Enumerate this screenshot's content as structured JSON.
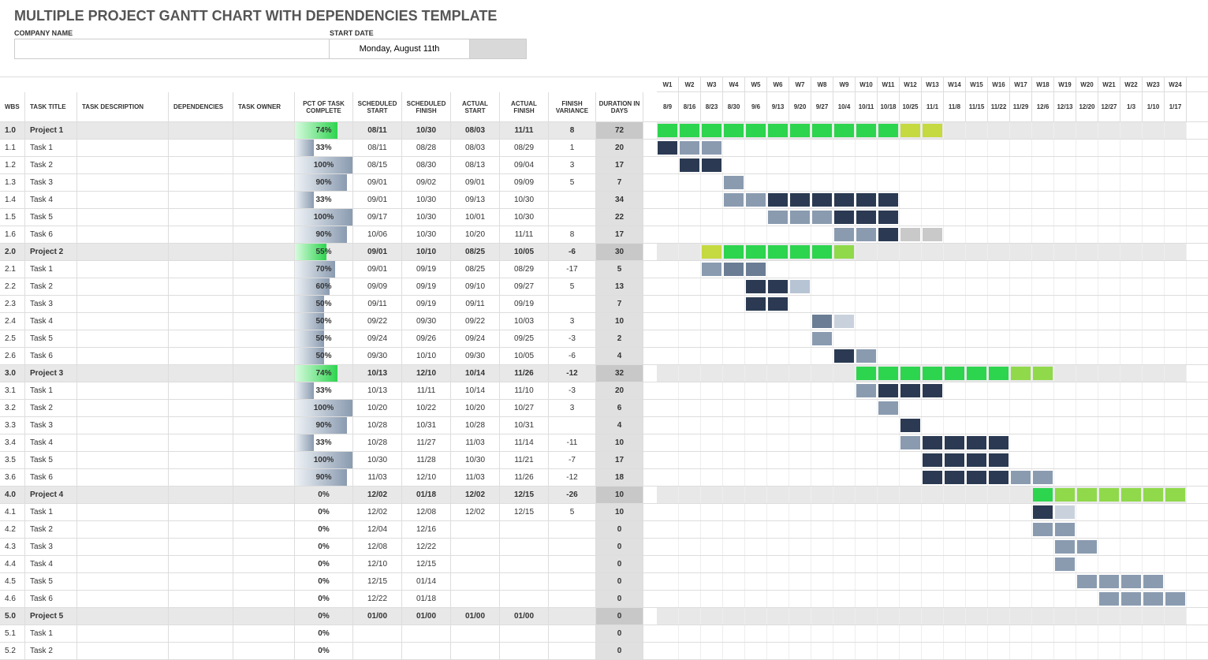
{
  "page_title": "MULTIPLE PROJECT GANTT CHART WITH DEPENDENCIES TEMPLATE",
  "labels": {
    "company": "COMPANY NAME",
    "start_date": "START DATE"
  },
  "start_date": "Monday, August 11th",
  "columns": {
    "wbs": "WBS",
    "title": "TASK TITLE",
    "desc": "TASK DESCRIPTION",
    "dep": "DEPENDENCIES",
    "own": "TASK OWNER",
    "pct": "PCT OF TASK COMPLETE",
    "ss": "SCHEDULED START",
    "sf": "SCHEDULED FINISH",
    "as": "ACTUAL START",
    "af": "ACTUAL FINISH",
    "var": "FINISH VARIANCE",
    "dur": "DURATION IN DAYS"
  },
  "weeks": [
    {
      "w": "W1",
      "d": "8/9"
    },
    {
      "w": "W2",
      "d": "8/16"
    },
    {
      "w": "W3",
      "d": "8/23"
    },
    {
      "w": "W4",
      "d": "8/30"
    },
    {
      "w": "W5",
      "d": "9/6"
    },
    {
      "w": "W6",
      "d": "9/13"
    },
    {
      "w": "W7",
      "d": "9/20"
    },
    {
      "w": "W8",
      "d": "9/27"
    },
    {
      "w": "W9",
      "d": "10/4"
    },
    {
      "w": "W10",
      "d": "10/11"
    },
    {
      "w": "W11",
      "d": "10/18"
    },
    {
      "w": "W12",
      "d": "10/25"
    },
    {
      "w": "W13",
      "d": "11/1"
    },
    {
      "w": "W14",
      "d": "11/8"
    },
    {
      "w": "W15",
      "d": "11/15"
    },
    {
      "w": "W16",
      "d": "11/22"
    },
    {
      "w": "W17",
      "d": "11/29"
    },
    {
      "w": "W18",
      "d": "12/6"
    },
    {
      "w": "W19",
      "d": "12/13"
    },
    {
      "w": "W20",
      "d": "12/20"
    },
    {
      "w": "W21",
      "d": "12/27"
    },
    {
      "w": "W22",
      "d": "1/3"
    },
    {
      "w": "W23",
      "d": "1/10"
    },
    {
      "w": "W24",
      "d": "1/17"
    }
  ],
  "rows": [
    {
      "proj": true,
      "wbs": "1.0",
      "title": "Project 1",
      "pct": "74%",
      "pctv": 74,
      "ss": "08/11",
      "sf": "10/30",
      "as": "08/03",
      "af": "11/11",
      "var": "8",
      "dur": "72",
      "bars": [
        {
          "s": 0,
          "e": 11,
          "c": "#2dd44e"
        },
        {
          "s": 11,
          "e": 13,
          "c": "#c5d941"
        }
      ]
    },
    {
      "wbs": "1.1",
      "title": "Task 1",
      "pct": "33%",
      "pctv": 33,
      "ss": "08/11",
      "sf": "08/28",
      "as": "08/03",
      "af": "08/29",
      "var": "1",
      "dur": "20",
      "bars": [
        {
          "s": 0,
          "e": 1,
          "c": "#2b3a52"
        },
        {
          "s": 1,
          "e": 3,
          "c": "#8a9bb0"
        }
      ]
    },
    {
      "wbs": "1.2",
      "title": "Task 2",
      "pct": "100%",
      "pctv": 100,
      "ss": "08/15",
      "sf": "08/30",
      "as": "08/13",
      "af": "09/04",
      "var": "3",
      "dur": "17",
      "bars": [
        {
          "s": 1,
          "e": 3,
          "c": "#2b3a52"
        }
      ]
    },
    {
      "wbs": "1.3",
      "title": "Task 3",
      "pct": "90%",
      "pctv": 90,
      "ss": "09/01",
      "sf": "09/02",
      "as": "09/01",
      "af": "09/09",
      "var": "5",
      "dur": "7",
      "bars": [
        {
          "s": 3,
          "e": 4,
          "c": "#8a9bb0"
        }
      ]
    },
    {
      "wbs": "1.4",
      "title": "Task 4",
      "pct": "33%",
      "pctv": 33,
      "ss": "09/01",
      "sf": "10/30",
      "as": "09/13",
      "af": "10/30",
      "var": "",
      "dur": "34",
      "bars": [
        {
          "s": 3,
          "e": 5,
          "c": "#8a9bb0"
        },
        {
          "s": 5,
          "e": 11,
          "c": "#2b3a52"
        }
      ]
    },
    {
      "wbs": "1.5",
      "title": "Task 5",
      "pct": "100%",
      "pctv": 100,
      "ss": "09/17",
      "sf": "10/30",
      "as": "10/01",
      "af": "10/30",
      "var": "",
      "dur": "22",
      "bars": [
        {
          "s": 5,
          "e": 8,
          "c": "#8a9bb0"
        },
        {
          "s": 8,
          "e": 11,
          "c": "#2b3a52"
        }
      ]
    },
    {
      "wbs": "1.6",
      "title": "Task 6",
      "pct": "90%",
      "pctv": 90,
      "ss": "10/06",
      "sf": "10/30",
      "as": "10/20",
      "af": "11/11",
      "var": "8",
      "dur": "17",
      "bars": [
        {
          "s": 8,
          "e": 10,
          "c": "#8a9bb0"
        },
        {
          "s": 10,
          "e": 11,
          "c": "#2b3a52"
        },
        {
          "s": 11,
          "e": 13,
          "c": "#c9c9c9"
        }
      ]
    },
    {
      "proj": true,
      "wbs": "2.0",
      "title": "Project 2",
      "pct": "55%",
      "pctv": 55,
      "ss": "09/01",
      "sf": "10/10",
      "as": "08/25",
      "af": "10/05",
      "var": "-6",
      "dur": "30",
      "bars": [
        {
          "s": 2,
          "e": 3,
          "c": "#c5d941"
        },
        {
          "s": 3,
          "e": 8,
          "c": "#2dd44e"
        },
        {
          "s": 8,
          "e": 9,
          "c": "#8fd94a"
        }
      ]
    },
    {
      "wbs": "2.1",
      "title": "Task 1",
      "pct": "70%",
      "pctv": 70,
      "ss": "09/01",
      "sf": "09/19",
      "as": "08/25",
      "af": "08/29",
      "var": "-17",
      "dur": "5",
      "bars": [
        {
          "s": 2,
          "e": 3,
          "c": "#8a9bb0"
        },
        {
          "s": 3,
          "e": 5,
          "c": "#6a7d94"
        }
      ]
    },
    {
      "wbs": "2.2",
      "title": "Task 2",
      "pct": "60%",
      "pctv": 60,
      "ss": "09/09",
      "sf": "09/19",
      "as": "09/10",
      "af": "09/27",
      "var": "5",
      "dur": "13",
      "bars": [
        {
          "s": 4,
          "e": 6,
          "c": "#2b3a52"
        },
        {
          "s": 6,
          "e": 7,
          "c": "#b7c4d4"
        }
      ]
    },
    {
      "wbs": "2.3",
      "title": "Task 3",
      "pct": "50%",
      "pctv": 50,
      "ss": "09/11",
      "sf": "09/19",
      "as": "09/11",
      "af": "09/19",
      "var": "",
      "dur": "7",
      "bars": [
        {
          "s": 4,
          "e": 6,
          "c": "#2b3a52"
        }
      ]
    },
    {
      "wbs": "2.4",
      "title": "Task 4",
      "pct": "50%",
      "pctv": 50,
      "ss": "09/22",
      "sf": "09/30",
      "as": "09/22",
      "af": "10/03",
      "var": "3",
      "dur": "10",
      "bars": [
        {
          "s": 7,
          "e": 8,
          "c": "#6a7d94"
        },
        {
          "s": 8,
          "e": 9,
          "c": "#c9d2dc"
        }
      ]
    },
    {
      "wbs": "2.5",
      "title": "Task 5",
      "pct": "50%",
      "pctv": 50,
      "ss": "09/24",
      "sf": "09/26",
      "as": "09/24",
      "af": "09/25",
      "var": "-3",
      "dur": "2",
      "bars": [
        {
          "s": 7,
          "e": 8,
          "c": "#8a9bb0"
        }
      ]
    },
    {
      "wbs": "2.6",
      "title": "Task 6",
      "pct": "50%",
      "pctv": 50,
      "ss": "09/30",
      "sf": "10/10",
      "as": "09/30",
      "af": "10/05",
      "var": "-6",
      "dur": "4",
      "bars": [
        {
          "s": 8,
          "e": 9,
          "c": "#2b3a52"
        },
        {
          "s": 9,
          "e": 10,
          "c": "#8a9bb0"
        }
      ]
    },
    {
      "proj": true,
      "wbs": "3.0",
      "title": "Project 3",
      "pct": "74%",
      "pctv": 74,
      "ss": "10/13",
      "sf": "12/10",
      "as": "10/14",
      "af": "11/26",
      "var": "-12",
      "dur": "32",
      "bars": [
        {
          "s": 9,
          "e": 16,
          "c": "#2dd44e"
        },
        {
          "s": 16,
          "e": 18,
          "c": "#8fd94a"
        }
      ]
    },
    {
      "wbs": "3.1",
      "title": "Task 1",
      "pct": "33%",
      "pctv": 33,
      "ss": "10/13",
      "sf": "11/11",
      "as": "10/14",
      "af": "11/10",
      "var": "-3",
      "dur": "20",
      "bars": [
        {
          "s": 9,
          "e": 10,
          "c": "#8a9bb0"
        },
        {
          "s": 10,
          "e": 13,
          "c": "#2b3a52"
        }
      ]
    },
    {
      "wbs": "3.2",
      "title": "Task 2",
      "pct": "100%",
      "pctv": 100,
      "ss": "10/20",
      "sf": "10/22",
      "as": "10/20",
      "af": "10/27",
      "var": "3",
      "dur": "6",
      "bars": [
        {
          "s": 10,
          "e": 11,
          "c": "#8a9bb0"
        }
      ]
    },
    {
      "wbs": "3.3",
      "title": "Task 3",
      "pct": "90%",
      "pctv": 90,
      "ss": "10/28",
      "sf": "10/31",
      "as": "10/28",
      "af": "10/31",
      "var": "",
      "dur": "4",
      "bars": [
        {
          "s": 11,
          "e": 12,
          "c": "#2b3a52"
        }
      ]
    },
    {
      "wbs": "3.4",
      "title": "Task 4",
      "pct": "33%",
      "pctv": 33,
      "ss": "10/28",
      "sf": "11/27",
      "as": "11/03",
      "af": "11/14",
      "var": "-11",
      "dur": "10",
      "bars": [
        {
          "s": 11,
          "e": 12,
          "c": "#8a9bb0"
        },
        {
          "s": 12,
          "e": 16,
          "c": "#2b3a52"
        }
      ]
    },
    {
      "wbs": "3.5",
      "title": "Task 5",
      "pct": "100%",
      "pctv": 100,
      "ss": "10/30",
      "sf": "11/28",
      "as": "10/30",
      "af": "11/21",
      "var": "-7",
      "dur": "17",
      "bars": [
        {
          "s": 12,
          "e": 16,
          "c": "#2b3a52"
        }
      ]
    },
    {
      "wbs": "3.6",
      "title": "Task 6",
      "pct": "90%",
      "pctv": 90,
      "ss": "11/03",
      "sf": "12/10",
      "as": "11/03",
      "af": "11/26",
      "var": "-12",
      "dur": "18",
      "bars": [
        {
          "s": 12,
          "e": 16,
          "c": "#2b3a52"
        },
        {
          "s": 16,
          "e": 18,
          "c": "#8a9bb0"
        }
      ]
    },
    {
      "proj": true,
      "wbs": "4.0",
      "title": "Project 4",
      "pct": "0%",
      "pctv": 0,
      "ss": "12/02",
      "sf": "01/18",
      "as": "12/02",
      "af": "12/15",
      "var": "-26",
      "dur": "10",
      "bars": [
        {
          "s": 17,
          "e": 18,
          "c": "#2dd44e"
        },
        {
          "s": 18,
          "e": 24,
          "c": "#8fd94a"
        }
      ]
    },
    {
      "wbs": "4.1",
      "title": "Task 1",
      "pct": "0%",
      "pctv": 0,
      "ss": "12/02",
      "sf": "12/08",
      "as": "12/02",
      "af": "12/15",
      "var": "5",
      "dur": "10",
      "bars": [
        {
          "s": 17,
          "e": 18,
          "c": "#2b3a52"
        },
        {
          "s": 18,
          "e": 19,
          "c": "#c9d2dc"
        }
      ]
    },
    {
      "wbs": "4.2",
      "title": "Task 2",
      "pct": "0%",
      "pctv": 0,
      "ss": "12/04",
      "sf": "12/16",
      "as": "",
      "af": "",
      "var": "",
      "dur": "0",
      "bars": [
        {
          "s": 17,
          "e": 19,
          "c": "#8a9bb0"
        }
      ]
    },
    {
      "wbs": "4.3",
      "title": "Task 3",
      "pct": "0%",
      "pctv": 0,
      "ss": "12/08",
      "sf": "12/22",
      "as": "",
      "af": "",
      "var": "",
      "dur": "0",
      "bars": [
        {
          "s": 18,
          "e": 20,
          "c": "#8a9bb0"
        }
      ]
    },
    {
      "wbs": "4.4",
      "title": "Task 4",
      "pct": "0%",
      "pctv": 0,
      "ss": "12/10",
      "sf": "12/15",
      "as": "",
      "af": "",
      "var": "",
      "dur": "0",
      "bars": [
        {
          "s": 18,
          "e": 19,
          "c": "#8a9bb0"
        }
      ]
    },
    {
      "wbs": "4.5",
      "title": "Task 5",
      "pct": "0%",
      "pctv": 0,
      "ss": "12/15",
      "sf": "01/14",
      "as": "",
      "af": "",
      "var": "",
      "dur": "0",
      "bars": [
        {
          "s": 19,
          "e": 23,
          "c": "#8a9bb0"
        }
      ]
    },
    {
      "wbs": "4.6",
      "title": "Task 6",
      "pct": "0%",
      "pctv": 0,
      "ss": "12/22",
      "sf": "01/18",
      "as": "",
      "af": "",
      "var": "",
      "dur": "0",
      "bars": [
        {
          "s": 20,
          "e": 24,
          "c": "#8a9bb0"
        }
      ]
    },
    {
      "proj": true,
      "wbs": "5.0",
      "title": "Project 5",
      "pct": "0%",
      "pctv": 0,
      "ss": "01/00",
      "sf": "01/00",
      "as": "01/00",
      "af": "01/00",
      "var": "",
      "dur": "0",
      "bars": []
    },
    {
      "wbs": "5.1",
      "title": "Task 1",
      "pct": "0%",
      "pctv": 0,
      "ss": "",
      "sf": "",
      "as": "",
      "af": "",
      "var": "",
      "dur": "0",
      "bars": []
    },
    {
      "wbs": "5.2",
      "title": "Task 2",
      "pct": "0%",
      "pctv": 0,
      "ss": "",
      "sf": "",
      "as": "",
      "af": "",
      "var": "",
      "dur": "0",
      "bars": []
    }
  ]
}
